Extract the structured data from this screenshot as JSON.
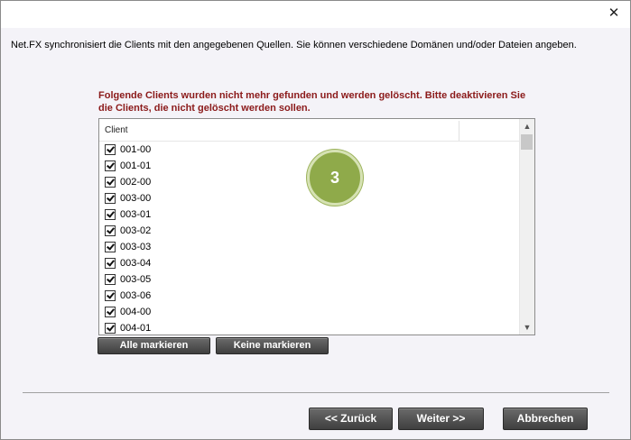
{
  "window": {
    "close_glyph": "✕"
  },
  "intro_text": "Net.FX synchronisiert die Clients mit den angegebenen Quellen. Sie können verschiedene Domänen und/oder Dateien angeben.",
  "warning_text": "Folgende Clients wurden nicht mehr gefunden und werden gelöscht. Bitte deaktivieren Sie die Clients, die nicht gelöscht werden sollen.",
  "list": {
    "column_header": "Client",
    "items": [
      {
        "label": "001-00",
        "checked": true
      },
      {
        "label": "001-01",
        "checked": true
      },
      {
        "label": "002-00",
        "checked": true
      },
      {
        "label": "003-00",
        "checked": true
      },
      {
        "label": "003-01",
        "checked": true
      },
      {
        "label": "003-02",
        "checked": true
      },
      {
        "label": "003-03",
        "checked": true
      },
      {
        "label": "003-04",
        "checked": true
      },
      {
        "label": "003-05",
        "checked": true
      },
      {
        "label": "003-06",
        "checked": true
      },
      {
        "label": "004-00",
        "checked": true
      },
      {
        "label": "004-01",
        "checked": true
      }
    ]
  },
  "step_badge": "3",
  "buttons": {
    "select_all": "Alle markieren",
    "select_none": "Keine markieren",
    "back": "<< Zurück",
    "next": "Weiter >>",
    "cancel": "Abbrechen"
  },
  "colors": {
    "warning": "#8b1a1a",
    "badge": "#8faa4a",
    "button_dark": "#4a4a4a"
  }
}
